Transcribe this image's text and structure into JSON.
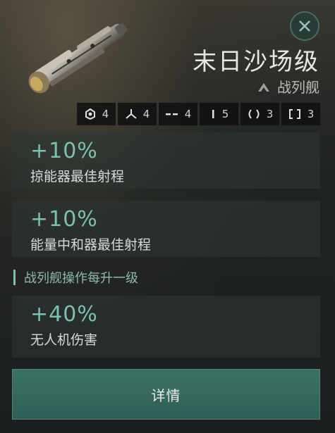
{
  "header": {
    "ship_name": "末日沙场级",
    "ship_class": "战列舰",
    "ship_image_icon": "ship-image",
    "class_icon": "chevron-up-icon",
    "close_icon": "close-icon"
  },
  "slots": [
    {
      "icon": "high-slot-icon",
      "count": "4"
    },
    {
      "icon": "mid-slot-icon",
      "count": "4"
    },
    {
      "icon": "low-slot-icon",
      "count": "4"
    },
    {
      "icon": "rig-slot-icon",
      "count": "5"
    },
    {
      "icon": "drone-slot-icon",
      "count": "3"
    },
    {
      "icon": "subsystem-slot-icon",
      "count": "3"
    }
  ],
  "bonuses": [
    {
      "value": "+10%",
      "label": "掠能器最佳射程"
    },
    {
      "value": "+10%",
      "label": "能量中和器最佳射程"
    }
  ],
  "level_section": {
    "heading": "战列舰操作每升一级",
    "bonuses": [
      {
        "value": "+40%",
        "label": "无人机伤害"
      }
    ]
  },
  "details_button": {
    "label": "详情"
  },
  "colors": {
    "accent": "#7cc0b0",
    "button": "#2f5f56",
    "background": "#1b1f1f"
  }
}
